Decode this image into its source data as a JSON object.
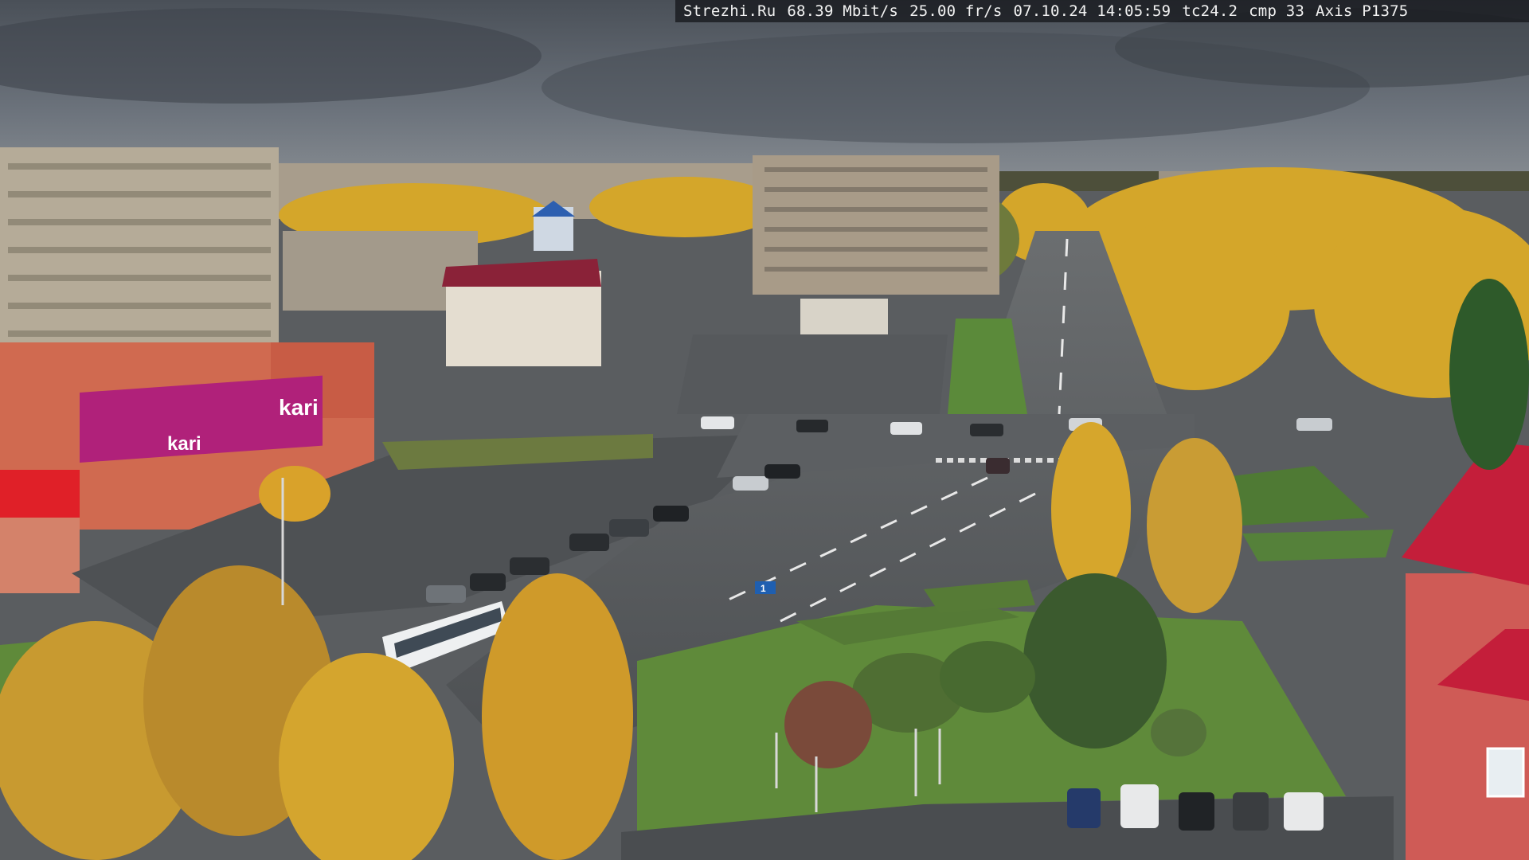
{
  "overlay": {
    "site": "Strezhi.Ru",
    "bitrate": "68.39 Mbit/s",
    "framerate": "25.00 fr/s",
    "datetime": "07.10.24 14:05:59",
    "tc": "tc24.2",
    "cmp": "cmp 33",
    "camera": "Axis P1375"
  },
  "signs": {
    "store_logo": "kari",
    "store_facade": "kari",
    "route_sign": "1"
  },
  "colors": {
    "sky": "#5c6470",
    "asphalt": "#5a5d60",
    "grass": "#5f8a3a",
    "foliage_yellow": "#d9a829",
    "kari_magenta": "#b0217a",
    "red_roof": "#c41e3a"
  }
}
